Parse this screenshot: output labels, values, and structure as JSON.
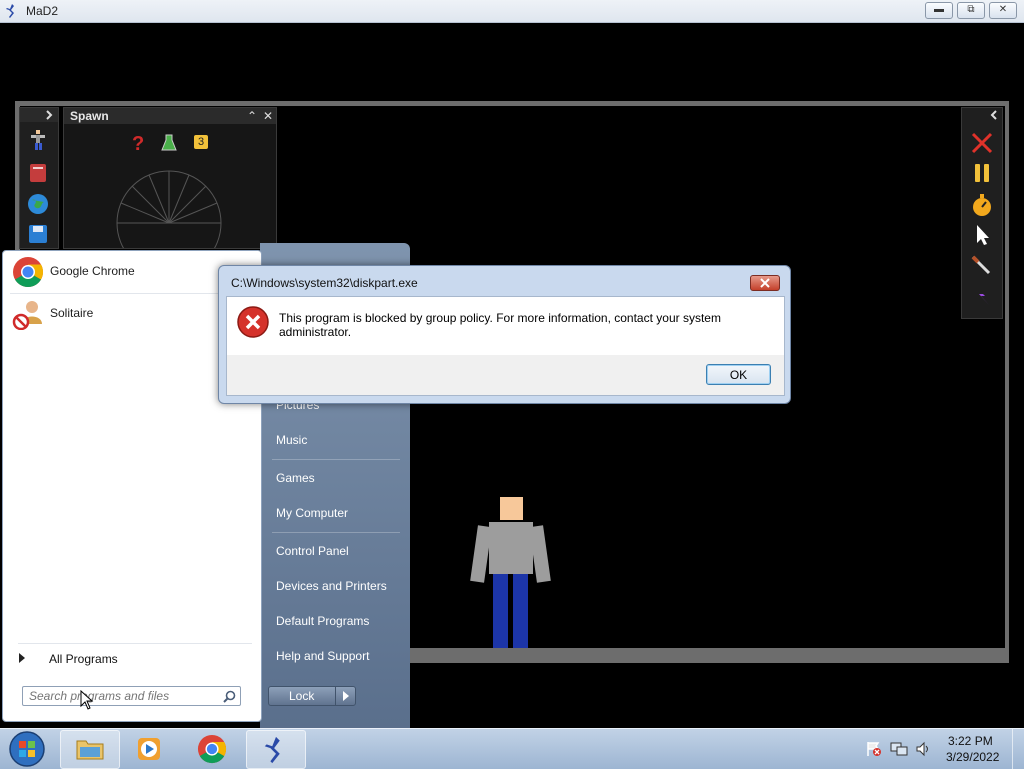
{
  "app": {
    "title": "MaD2"
  },
  "spawn_panel": {
    "title": "Spawn",
    "badge": "3"
  },
  "start_menu": {
    "pinned": [
      {
        "label": "Google Chrome",
        "icon": "chrome-icon"
      },
      {
        "label": "Solitaire",
        "icon": "solitaire-icon"
      }
    ],
    "all_programs": "All Programs",
    "search_placeholder": "Search programs and files",
    "right_items": [
      "Pictures",
      "Music",
      "Games",
      "My Computer",
      "Control Panel",
      "Devices and Printers",
      "Default Programs",
      "Help and Support"
    ],
    "lock_label": "Lock"
  },
  "dialog": {
    "title": "C:\\Windows\\system32\\diskpart.exe",
    "message": "This program is blocked by group policy. For more information, contact your system administrator.",
    "ok_label": "OK",
    "icon": "error-icon"
  },
  "taskbar": {
    "items": [
      "start-orb",
      "explorer-icon",
      "media-player-icon",
      "chrome-icon",
      "mad2-icon"
    ],
    "time": "3:22 PM",
    "date": "3/29/2022"
  },
  "colors": {
    "start_panel_right": "#6b809c",
    "dialog_frame": "#c9d9ee",
    "error_red": "#d5322b",
    "ragdoll_shirt": "#9d9d9d",
    "ragdoll_pants": "#1c35a8",
    "ragdoll_head": "#f7c89a"
  }
}
